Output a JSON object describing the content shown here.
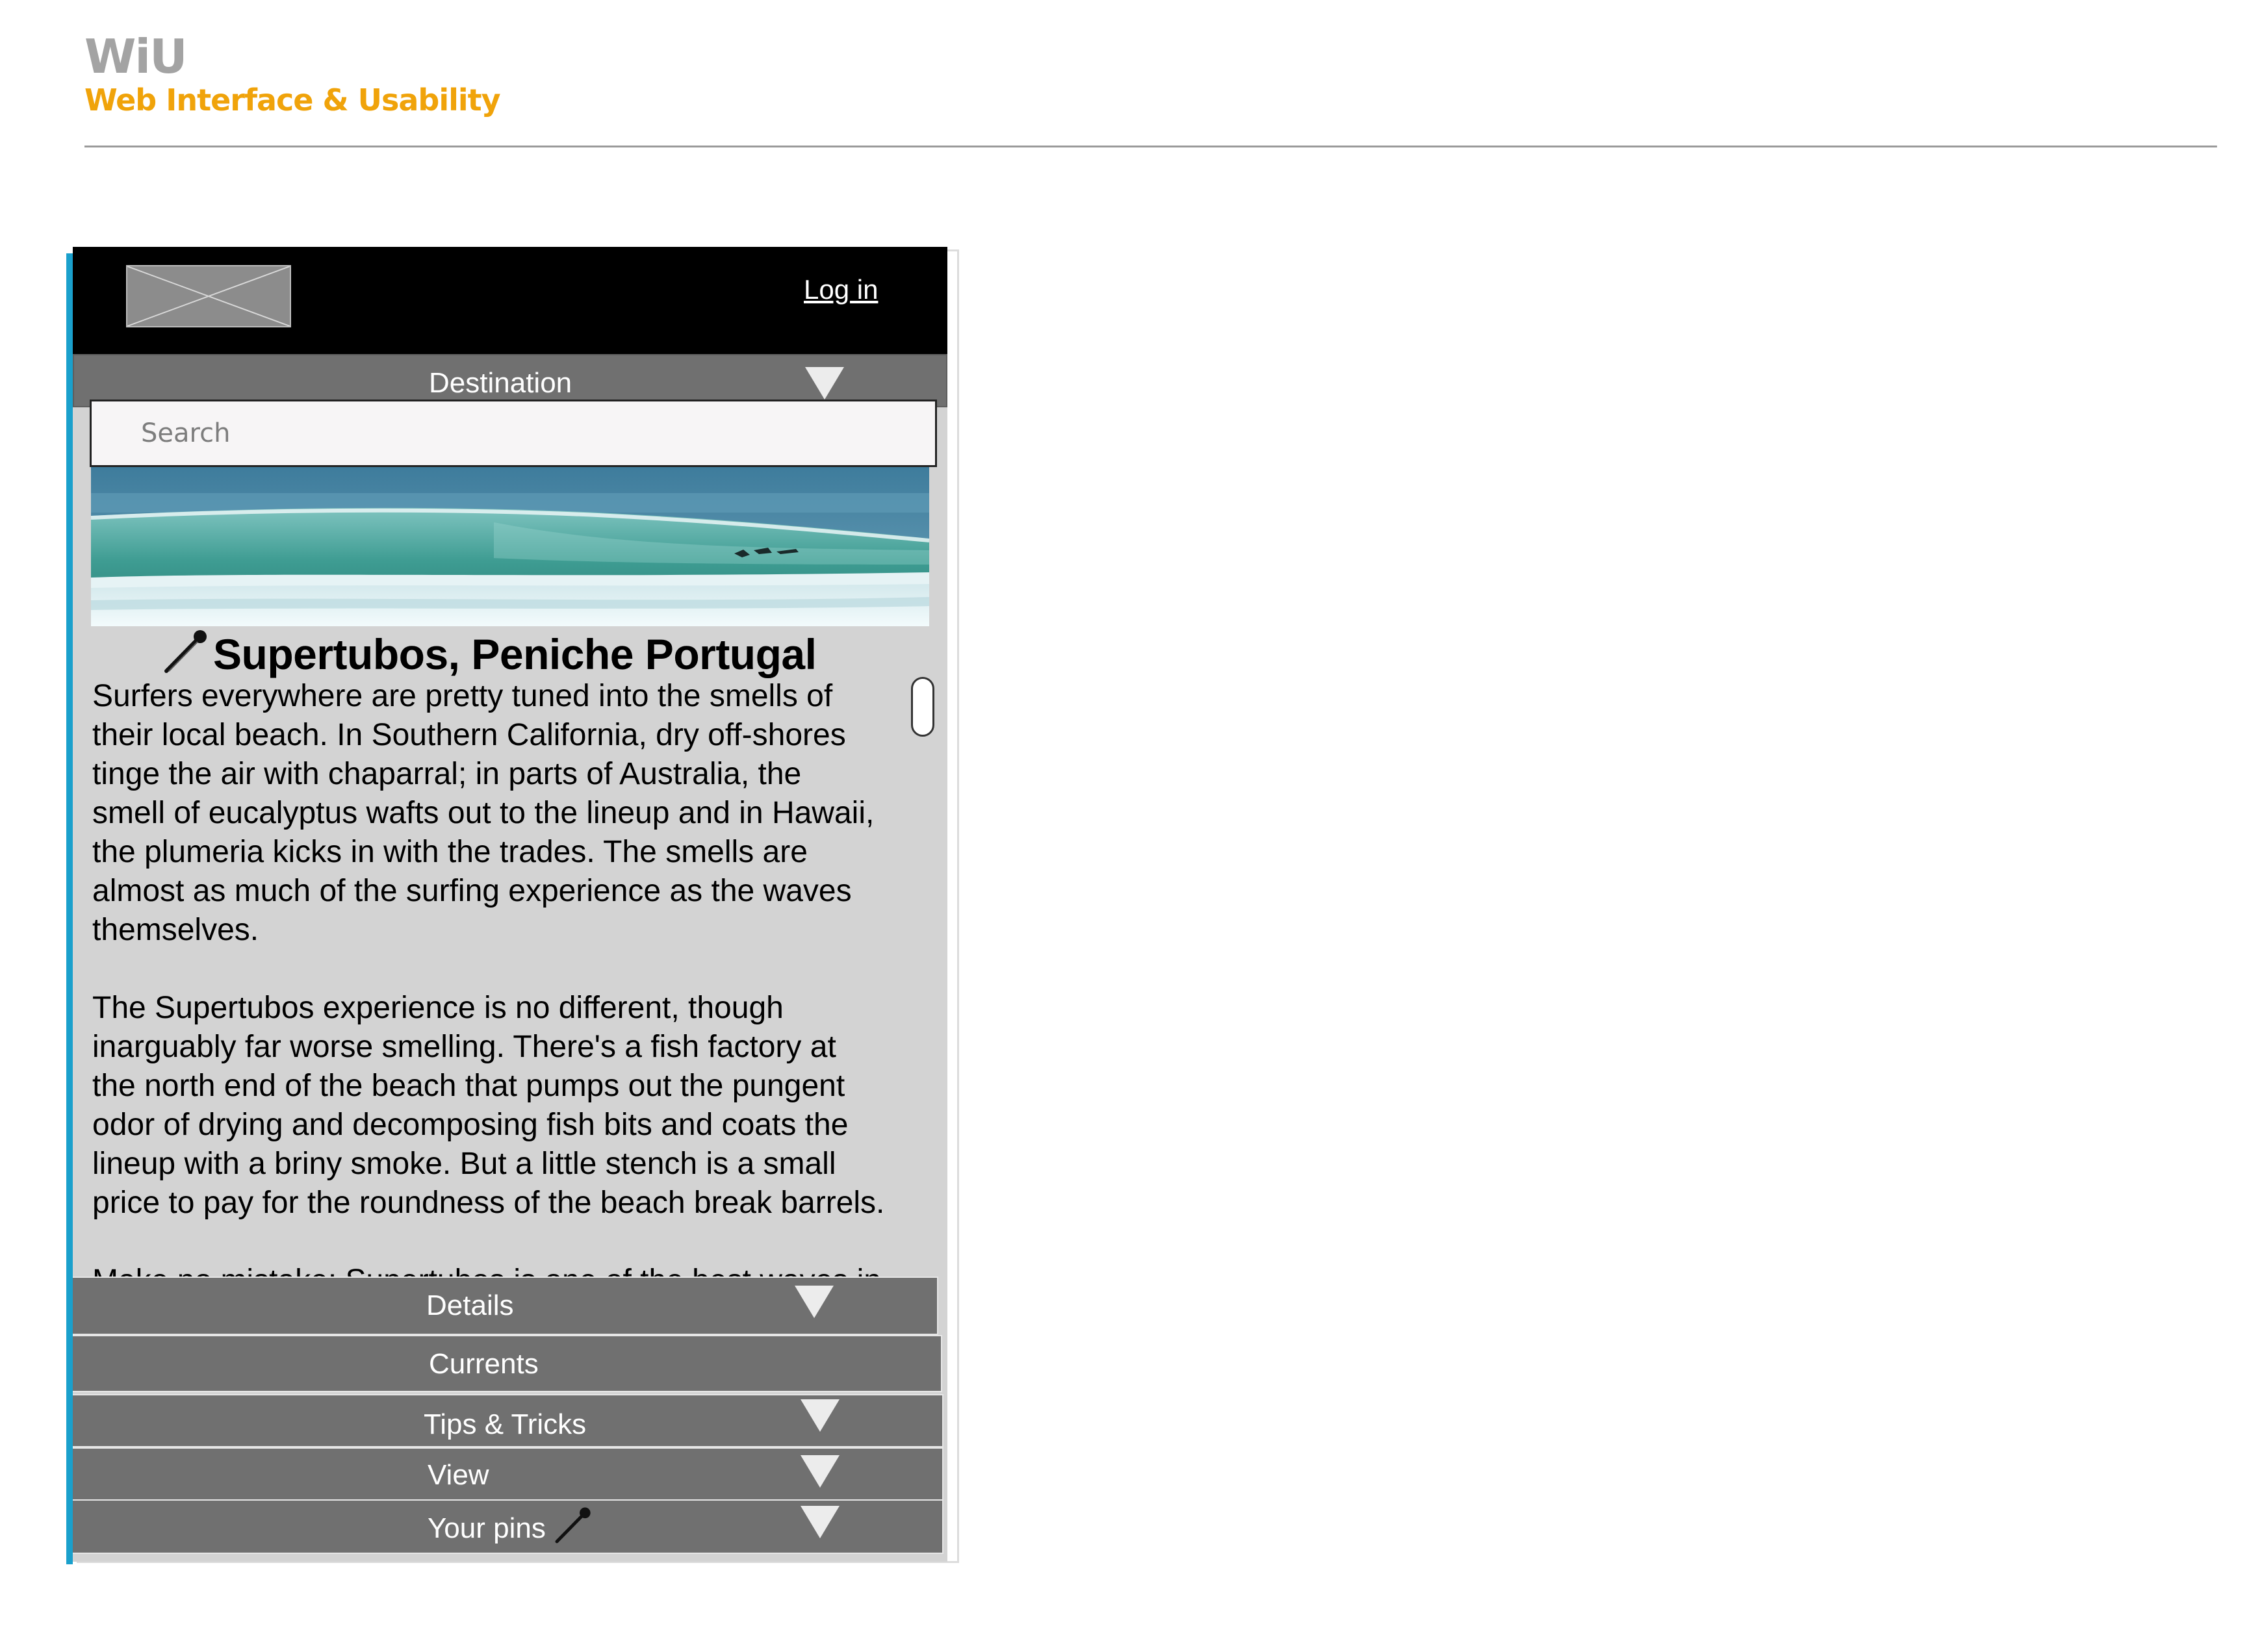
{
  "brand": {
    "logo": "WiU",
    "tagline": "Web Interface & Usability"
  },
  "header": {
    "login_label": "Log in",
    "logo_placeholder_icon": "image-placeholder-icon"
  },
  "destination": {
    "label": "Destination"
  },
  "search": {
    "placeholder": "Search",
    "value": ""
  },
  "article": {
    "title": "Supertubos, Peniche Portugal",
    "paragraphs": [
      "Surfers everywhere are pretty tuned into the smells of\ntheir local beach. In Southern California, dry off-shores\ntinge the air with chaparral; in parts of Australia, the\nsmell of eucalyptus wafts out to the lineup and in Hawaii,\n the plumeria kicks in with the trades. The smells are\nalmost as much of the surfing experience as the waves\nthemselves.",
      "The Supertubos experience is no different, though\ninarguably far worse smelling. There's a fish factory at\nthe north end of the beach that pumps out the pungent\n odor of drying and decomposing fish bits and coats the\n lineup with a briny smoke. But a little stench is a small\nprice to pay for the roundness of the beach break barrels.",
      "Make no mistake: Supertubos is one of the best waves in"
    ]
  },
  "accordion": {
    "details": "Details",
    "currents": "Currents",
    "tips": "Tips & Tricks",
    "view": "View",
    "pins": "Your pins"
  },
  "colors": {
    "accent": "#1aa0cc",
    "brand_orange": "#f0a30a",
    "bar_gray": "#707070",
    "panel_gray": "#d3d3d3"
  }
}
